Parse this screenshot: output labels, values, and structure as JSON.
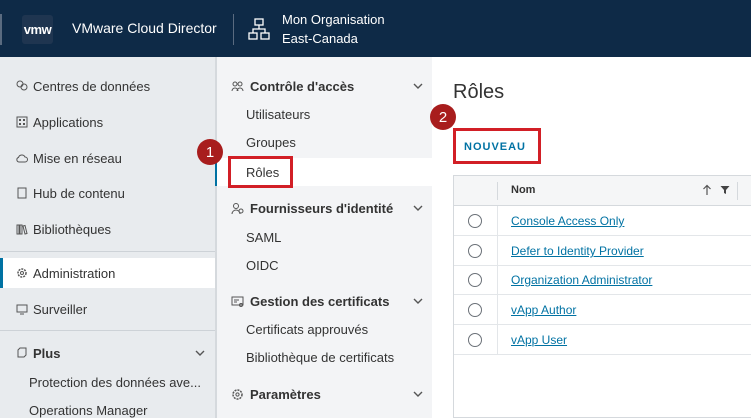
{
  "header": {
    "logo": "vmw",
    "app_title": "VMware Cloud Director",
    "org_name": "Mon Organisation",
    "org_region": "East-Canada"
  },
  "leftnav": {
    "items": [
      {
        "label": "Centres de données",
        "icon": "datacenter-icon"
      },
      {
        "label": "Applications",
        "icon": "applications-icon"
      },
      {
        "label": "Mise en réseau",
        "icon": "cloud-icon"
      },
      {
        "label": "Hub de contenu",
        "icon": "content-hub-icon"
      },
      {
        "label": "Bibliothèques",
        "icon": "library-icon"
      },
      {
        "label": "Administration",
        "icon": "gear-icon"
      },
      {
        "label": "Surveiller",
        "icon": "monitor-icon"
      },
      {
        "label": "Plus",
        "icon": "plus-icon"
      }
    ],
    "sub_items": [
      "Protection des données ave...",
      "Operations Manager"
    ]
  },
  "subnav": {
    "groups": [
      {
        "label": "Contrôle d'accès",
        "items": [
          "Utilisateurs",
          "Groupes",
          "Rôles"
        ]
      },
      {
        "label": "Fournisseurs d'identité",
        "items": [
          "SAML",
          "OIDC"
        ]
      },
      {
        "label": "Gestion des certificats",
        "items": [
          "Certificats approuvés",
          "Bibliothèque de certificats"
        ]
      },
      {
        "label": "Paramètres",
        "items": []
      }
    ]
  },
  "main": {
    "title": "Rôles",
    "new_button": "NOUVEAU",
    "grid": {
      "column_name": "Nom",
      "rows": [
        "Console Access Only",
        "Defer to Identity Provider",
        "Organization Administrator",
        "vApp Author",
        "vApp User"
      ]
    }
  },
  "annotations": {
    "badge1": "1",
    "badge2": "2"
  },
  "colors": {
    "header_bg": "#0e2a47",
    "accent": "#0072a3",
    "highlight_red": "#d21f26",
    "badge_red": "#a81d1d"
  }
}
